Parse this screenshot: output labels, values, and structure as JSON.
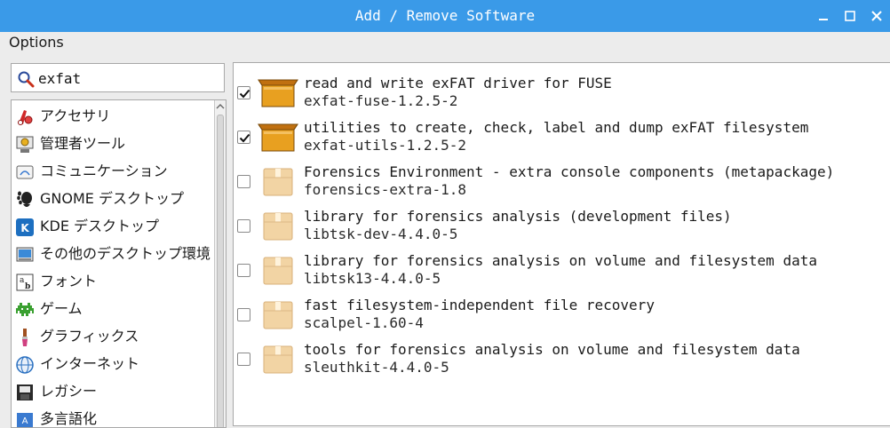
{
  "window": {
    "title": "Add / Remove Software"
  },
  "menubar": {
    "options_label": "Options"
  },
  "search": {
    "value": "exfat"
  },
  "categories": [
    {
      "label": "アクセサリ",
      "icon": "accessories-icon"
    },
    {
      "label": "管理者ツール",
      "icon": "admin-tools-icon"
    },
    {
      "label": "コミュニケーション",
      "icon": "communication-icon"
    },
    {
      "label": "GNOME デスクトップ",
      "icon": "gnome-icon"
    },
    {
      "label": "KDE デスクトップ",
      "icon": "kde-icon"
    },
    {
      "label": "その他のデスクトップ環境",
      "icon": "other-desktop-icon"
    },
    {
      "label": "フォント",
      "icon": "fonts-icon"
    },
    {
      "label": "ゲーム",
      "icon": "games-icon"
    },
    {
      "label": "グラフィックス",
      "icon": "graphics-icon"
    },
    {
      "label": "インターネット",
      "icon": "internet-icon"
    },
    {
      "label": "レガシー",
      "icon": "legacy-icon"
    },
    {
      "label": "多言語化",
      "icon": "localization-icon"
    }
  ],
  "packages": [
    {
      "title": "read and write exFAT driver for FUSE",
      "version": "exfat-fuse-1.2.5-2",
      "installed": true
    },
    {
      "title": "utilities to create, check, label and dump exFAT filesystem",
      "version": "exfat-utils-1.2.5-2",
      "installed": true
    },
    {
      "title": "Forensics Environment - extra console components (metapackage)",
      "version": "forensics-extra-1.8",
      "installed": false
    },
    {
      "title": "library for forensics analysis (development files)",
      "version": "libtsk-dev-4.4.0-5",
      "installed": false
    },
    {
      "title": "library for forensics analysis on volume and filesystem data",
      "version": "libtsk13-4.4.0-5",
      "installed": false
    },
    {
      "title": "fast filesystem-independent file recovery",
      "version": "scalpel-1.60-4",
      "installed": false
    },
    {
      "title": "tools for forensics analysis on volume and filesystem data",
      "version": "sleuthkit-4.4.0-5",
      "installed": false
    }
  ],
  "colors": {
    "titlebar": "#3a9ae8",
    "installed_box": "#e8a020",
    "available_box": "#f2d4a4"
  }
}
